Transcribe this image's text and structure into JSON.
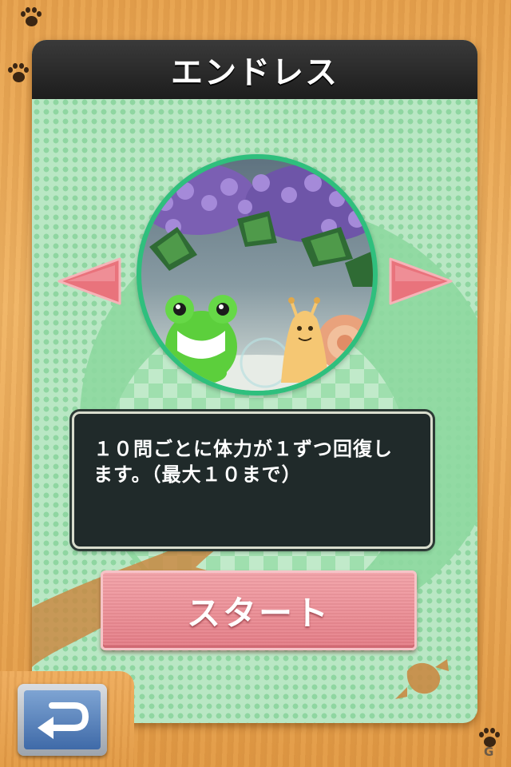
{
  "header": {
    "title": "エンドレス"
  },
  "message": {
    "text": "１０問ごとに体力が１ずつ回復し\nます。（最大１０まで）"
  },
  "start_button": {
    "label": "スタート"
  },
  "icons": {
    "prev": "arrow-left-icon",
    "next": "arrow-right-icon",
    "back": "return-arrow-icon",
    "decor": "paw-print-icon"
  },
  "colors": {
    "header_bg": "#1d1d1d",
    "panel_dots": "#8fd6a1",
    "stage_border": "#2fbf7d",
    "arrow": "#e9737c",
    "start_button": "#e47c85",
    "back_button": "#3f6aa8"
  }
}
